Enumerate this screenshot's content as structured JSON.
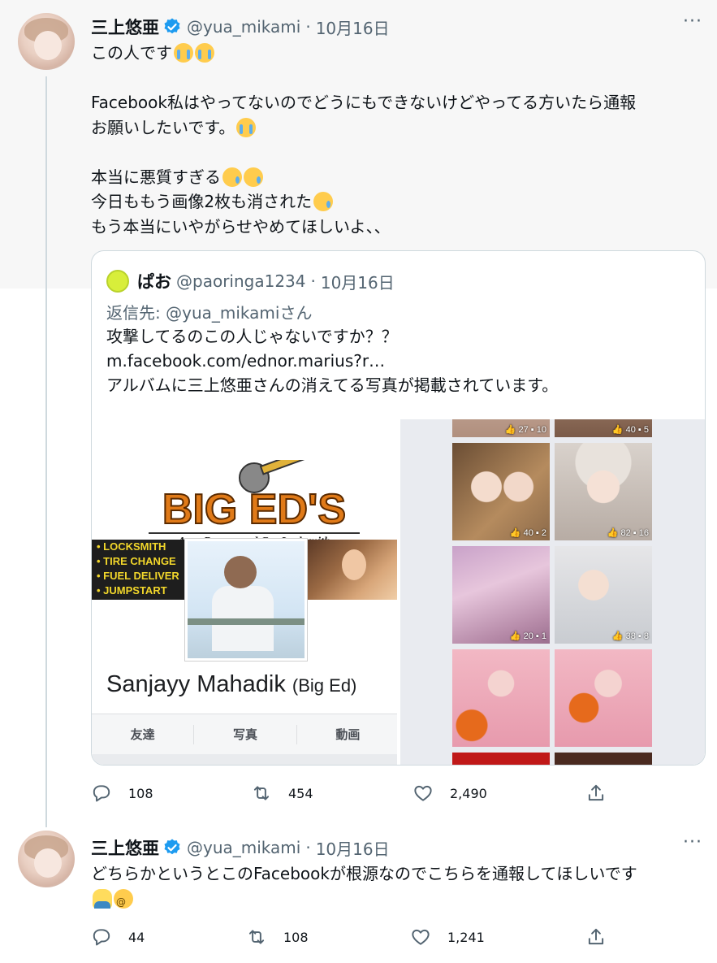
{
  "tweets": [
    {
      "author_name": "三上悠亜",
      "handle": "@yua_mikami",
      "separator": "·",
      "date": "10月16日",
      "more": "···",
      "lines": [
        "この人です",
        "",
        "Facebook私はやってないのでどうにもできないけどやってる方いたら通報",
        "お願いしたいです。",
        "",
        "本当に悪質すぎる",
        "今日ももう画像2枚も消された",
        "もう本当にいやがらせやめてほしいよ、、"
      ],
      "quote": {
        "author_name": "ぱお",
        "handle": "@paoringa1234",
        "separator": "·",
        "date": "10月16日",
        "reply_prefix": "返信先: ",
        "reply_mention": "@yua_mikamiさん",
        "lines": [
          "攻撃してるのこの人じゃないですか？？",
          "m.facebook.com/ednor.marius?r…",
          "アルバムに三上悠亜さんの消えてる写真が掲載されています。"
        ],
        "media_left": {
          "logo_text": "BIG ED'S",
          "logo_tagline": "Auto Rescue and Car Locksmith",
          "banner_items": [
            "• LOCKSMITH",
            "• TIRE CHANGE",
            "• FUEL DELIVER",
            "• JUMPSTART"
          ],
          "profile_name": "Sanjayy Mahadik",
          "profile_alt_name": "(Big Ed)",
          "tabs": [
            "友達",
            "写真",
            "動画"
          ]
        },
        "media_right": {
          "photos": [
            {
              "likes": "27",
              "comments": "10"
            },
            {
              "likes": "40",
              "comments": "5"
            },
            {
              "likes": "40",
              "comments": "2"
            },
            {
              "likes": "82",
              "comments": "16"
            },
            {
              "likes": "20",
              "comments": "1"
            },
            {
              "likes": "38",
              "comments": "8"
            },
            {
              "likes": "",
              "comments": ""
            },
            {
              "likes": "",
              "comments": ""
            }
          ]
        }
      },
      "replies": "108",
      "retweets": "454",
      "likes": "2,490"
    },
    {
      "author_name": "三上悠亜",
      "handle": "@yua_mikami",
      "separator": "·",
      "date": "10月16日",
      "more": "···",
      "lines": [
        "どちらかというとこのFacebookが根源なのでこちらを通報してほしいです"
      ],
      "replies": "44",
      "retweets": "108",
      "likes": "1,241"
    }
  ],
  "icons": {
    "verified": "verified-badge-icon",
    "reply": "reply-icon",
    "retweet": "retweet-icon",
    "like": "heart-icon",
    "share": "share-icon",
    "more": "more-icon"
  },
  "colors": {
    "verified": "#1d9bf0",
    "secondary_text": "#536471",
    "thread_line": "#cfd9de",
    "thread_bg": "#f7f7f7"
  }
}
